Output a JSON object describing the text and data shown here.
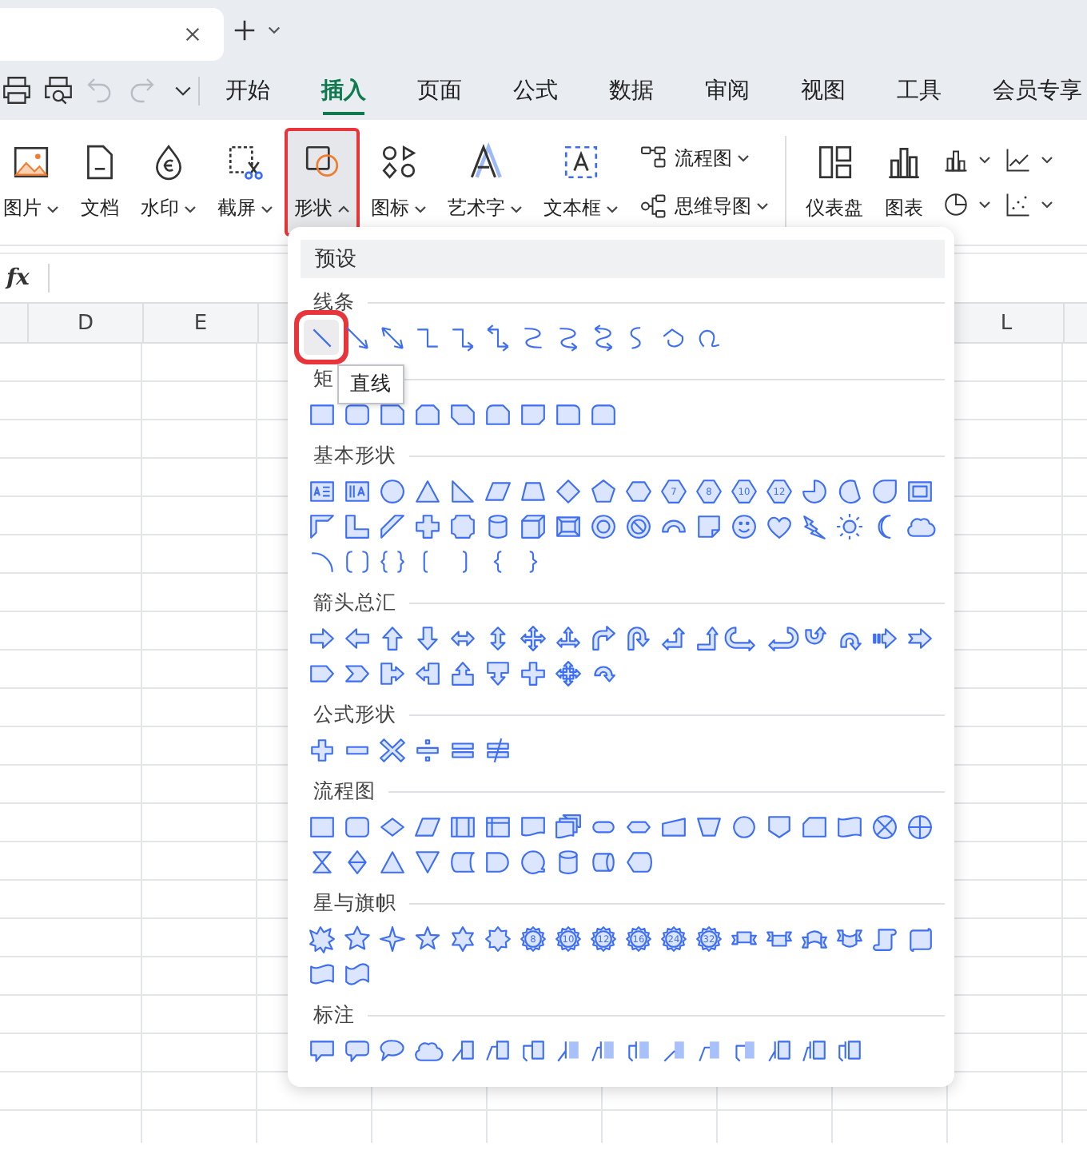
{
  "quick_access": [
    {
      "kind": "print",
      "disabled": false
    },
    {
      "kind": "preview",
      "disabled": false
    },
    {
      "kind": "undo",
      "disabled": true
    },
    {
      "kind": "redo",
      "disabled": true
    },
    {
      "kind": "more",
      "disabled": false
    }
  ],
  "menu_tabs": [
    {
      "label": "开始",
      "selected": false
    },
    {
      "label": "插入",
      "selected": true
    },
    {
      "label": "页面",
      "selected": false
    },
    {
      "label": "公式",
      "selected": false
    },
    {
      "label": "数据",
      "selected": false
    },
    {
      "label": "审阅",
      "selected": false
    },
    {
      "label": "视图",
      "selected": false
    },
    {
      "label": "工具",
      "selected": false
    },
    {
      "label": "会员专享",
      "selected": false
    }
  ],
  "ribbon": {
    "large": [
      {
        "label": "图片",
        "kind": "picture",
        "dropdown": true,
        "expanded": false
      },
      {
        "label": "文档",
        "kind": "document",
        "dropdown": false,
        "expanded": false
      },
      {
        "label": "水印",
        "kind": "watermark",
        "dropdown": true,
        "expanded": false
      },
      {
        "label": "截屏",
        "kind": "screenshot",
        "dropdown": true,
        "expanded": false
      },
      {
        "label": "形状",
        "kind": "shapes",
        "dropdown": true,
        "expanded": true
      },
      {
        "label": "图标",
        "kind": "icons",
        "dropdown": true,
        "expanded": false
      },
      {
        "label": "艺术字",
        "kind": "wordart",
        "dropdown": true,
        "expanded": false
      },
      {
        "label": "文本框",
        "kind": "textbox",
        "dropdown": true,
        "expanded": false
      }
    ],
    "stacked": [
      {
        "label": "流程图",
        "kind": "flowchart",
        "dropdown": true
      },
      {
        "label": "思维导图",
        "kind": "mindmap",
        "dropdown": true
      }
    ],
    "charts": [
      {
        "label": "仪表盘",
        "kind": "dashboard"
      },
      {
        "label": "图表",
        "kind": "chart"
      }
    ],
    "mini": [
      {
        "kind": "barchart",
        "dropdown": true
      },
      {
        "kind": "linechart",
        "dropdown": true
      },
      {
        "kind": "piechart",
        "dropdown": true
      },
      {
        "kind": "scatterchart",
        "dropdown": true
      }
    ]
  },
  "formula_bar": {
    "label": "fx"
  },
  "columns": [
    {
      "label": "D"
    },
    {
      "label": "E"
    },
    {
      "label": "L"
    }
  ],
  "shapes_panel": {
    "header": "预设",
    "tooltip": "直线",
    "sections": [
      {
        "title": "线条",
        "shapes": [
          {
            "kind": "line",
            "selected": true
          },
          {
            "kind": "arrow",
            "selected": false
          },
          {
            "kind": "doublearrow",
            "selected": false
          },
          {
            "kind": "elbow",
            "selected": false
          },
          {
            "kind": "elbowarrow",
            "selected": false
          },
          {
            "kind": "elbowdoublearrow",
            "selected": false
          },
          {
            "kind": "curve",
            "selected": false
          },
          {
            "kind": "curvearrow",
            "selected": false
          },
          {
            "kind": "curvedoublearrow",
            "selected": false
          },
          {
            "kind": "freeform",
            "selected": false
          },
          {
            "kind": "scribble",
            "selected": false
          },
          {
            "kind": "squiggle",
            "selected": false
          }
        ]
      },
      {
        "title": "矩",
        "shapes": [
          {
            "kind": "rectangle",
            "selected": false
          },
          {
            "kind": "rounded",
            "selected": false
          },
          {
            "kind": "snipped",
            "selected": false
          },
          {
            "kind": "snippedpair",
            "selected": false
          },
          {
            "kind": "snippeddiagonal",
            "selected": false
          },
          {
            "kind": "roundsnip",
            "selected": false
          },
          {
            "kind": "snipcorner",
            "selected": false
          },
          {
            "kind": "roundcorner",
            "selected": false
          },
          {
            "kind": "roundtop",
            "selected": false
          }
        ]
      },
      {
        "title": "基本形状",
        "shapes": [
          {
            "kind": "textbox",
            "selected": false
          },
          {
            "kind": "verticaltextbox",
            "selected": false
          },
          {
            "kind": "circle",
            "selected": false
          },
          {
            "kind": "triangle",
            "selected": false
          },
          {
            "kind": "righttriangle",
            "selected": false
          },
          {
            "kind": "parallelogram",
            "selected": false
          },
          {
            "kind": "trapezoid",
            "selected": false
          },
          {
            "kind": "diamond",
            "selected": false
          },
          {
            "kind": "pentagon",
            "selected": false
          },
          {
            "kind": "hexagon",
            "selected": false
          },
          {
            "kind": "polygon",
            "label": "7",
            "selected": false
          },
          {
            "kind": "polygon",
            "label": "8",
            "selected": false
          },
          {
            "kind": "polygon",
            "label": "10",
            "selected": false
          },
          {
            "kind": "polygon",
            "label": "12",
            "selected": false
          },
          {
            "kind": "pie",
            "selected": false
          },
          {
            "kind": "chord",
            "selected": false
          },
          {
            "kind": "teardrop",
            "selected": false
          },
          {
            "kind": "frame",
            "selected": false
          },
          {
            "kind": "halfframe",
            "selected": false
          },
          {
            "kind": "lshape",
            "selected": false
          },
          {
            "kind": "stripe",
            "selected": false
          },
          {
            "kind": "cross",
            "selected": false
          },
          {
            "kind": "plaque",
            "selected": false
          },
          {
            "kind": "can",
            "selected": false
          },
          {
            "kind": "cube",
            "selected": false
          },
          {
            "kind": "bevel",
            "selected": false
          },
          {
            "kind": "donut",
            "selected": false
          },
          {
            "kind": "prohibition",
            "selected": false
          },
          {
            "kind": "blockarc",
            "selected": false
          },
          {
            "kind": "foldedcorner",
            "selected": false
          },
          {
            "kind": "smiley",
            "selected": false
          },
          {
            "kind": "heart",
            "selected": false
          },
          {
            "kind": "lightning",
            "selected": false
          },
          {
            "kind": "sun",
            "selected": false
          },
          {
            "kind": "moon",
            "selected": false
          },
          {
            "kind": "cloud",
            "selected": false
          },
          {
            "kind": "arc",
            "selected": false
          },
          {
            "kind": "bracketpair",
            "selected": false
          },
          {
            "kind": "bracepair",
            "selected": false
          },
          {
            "kind": "leftbracket",
            "selected": false
          },
          {
            "kind": "rightbracket",
            "selected": false
          },
          {
            "kind": "leftbrace",
            "selected": false
          },
          {
            "kind": "rightbrace",
            "selected": false
          }
        ]
      },
      {
        "title": "箭头总汇",
        "shapes": [
          {
            "kind": "rightarrow",
            "selected": false
          },
          {
            "kind": "leftarrow",
            "selected": false
          },
          {
            "kind": "uparrow",
            "selected": false
          },
          {
            "kind": "downarrow",
            "selected": false
          },
          {
            "kind": "leftrightarrow",
            "selected": false
          },
          {
            "kind": "updownarrow",
            "selected": false
          },
          {
            "kind": "quadarrow",
            "selected": false
          },
          {
            "kind": "triarrow",
            "selected": false
          },
          {
            "kind": "bentarrow",
            "selected": false
          },
          {
            "kind": "uturnarrow",
            "selected": false
          },
          {
            "kind": "leftuparrow",
            "selected": false
          },
          {
            "kind": "bentuparrow",
            "selected": false
          },
          {
            "kind": "curvedright",
            "selected": false
          },
          {
            "kind": "curvedleft",
            "selected": false
          },
          {
            "kind": "curvedup",
            "selected": false
          },
          {
            "kind": "curveddown",
            "selected": false
          },
          {
            "kind": "stripedarrow",
            "selected": false
          },
          {
            "kind": "notchedarrow",
            "selected": false
          },
          {
            "kind": "homeplate",
            "selected": false
          },
          {
            "kind": "chevron",
            "selected": false
          },
          {
            "kind": "rightcallout",
            "selected": false
          },
          {
            "kind": "leftcallout",
            "selected": false
          },
          {
            "kind": "upcallout",
            "selected": false
          },
          {
            "kind": "downcallout",
            "selected": false
          },
          {
            "kind": "plusarrow",
            "selected": false
          },
          {
            "kind": "quadcallout",
            "selected": false
          },
          {
            "kind": "circulararrow",
            "selected": false
          }
        ]
      },
      {
        "title": "公式形状",
        "shapes": [
          {
            "kind": "plus",
            "selected": false
          },
          {
            "kind": "minus",
            "selected": false
          },
          {
            "kind": "multiply",
            "selected": false
          },
          {
            "kind": "divide",
            "selected": false
          },
          {
            "kind": "equal",
            "selected": false
          },
          {
            "kind": "notequal",
            "selected": false
          }
        ]
      },
      {
        "title": "流程图",
        "shapes": [
          {
            "kind": "process",
            "selected": false
          },
          {
            "kind": "alternate",
            "selected": false
          },
          {
            "kind": "decision",
            "selected": false
          },
          {
            "kind": "data",
            "selected": false
          },
          {
            "kind": "predefined",
            "selected": false
          },
          {
            "kind": "internalstorage",
            "selected": false
          },
          {
            "kind": "document",
            "selected": false
          },
          {
            "kind": "multidocument",
            "selected": false
          },
          {
            "kind": "terminator",
            "selected": false
          },
          {
            "kind": "preparation",
            "selected": false
          },
          {
            "kind": "manualinput",
            "selected": false
          },
          {
            "kind": "manualoperation",
            "selected": false
          },
          {
            "kind": "connector",
            "selected": false
          },
          {
            "kind": "offpage",
            "selected": false
          },
          {
            "kind": "card",
            "selected": false
          },
          {
            "kind": "tape",
            "selected": false
          },
          {
            "kind": "summing",
            "selected": false
          },
          {
            "kind": "orgate",
            "selected": false
          },
          {
            "kind": "collate",
            "selected": false
          },
          {
            "kind": "sort",
            "selected": false
          },
          {
            "kind": "extract",
            "selected": false
          },
          {
            "kind": "merge",
            "selected": false
          },
          {
            "kind": "storeddata",
            "selected": false
          },
          {
            "kind": "delay",
            "selected": false
          },
          {
            "kind": "sequential",
            "selected": false
          },
          {
            "kind": "magneticdisk",
            "selected": false
          },
          {
            "kind": "directaccess",
            "selected": false
          },
          {
            "kind": "display",
            "selected": false
          }
        ]
      },
      {
        "title": "星与旗帜",
        "shapes": [
          {
            "kind": "explosion",
            "selected": false
          },
          {
            "kind": "blast",
            "selected": false
          },
          {
            "kind": "sparkle",
            "selected": false
          },
          {
            "kind": "star",
            "selected": false
          },
          {
            "kind": "hexagram",
            "selected": false
          },
          {
            "kind": "burst",
            "selected": false
          },
          {
            "kind": "seal",
            "label": "8",
            "selected": false
          },
          {
            "kind": "seal",
            "label": "10",
            "selected": false
          },
          {
            "kind": "seal",
            "label": "12",
            "selected": false
          },
          {
            "kind": "seal",
            "label": "16",
            "selected": false
          },
          {
            "kind": "seal",
            "label": "24",
            "selected": false
          },
          {
            "kind": "seal",
            "label": "32",
            "selected": false
          },
          {
            "kind": "ribbon",
            "selected": false
          },
          {
            "kind": "upribbon",
            "selected": false
          },
          {
            "kind": "curvedribbon",
            "selected": false
          },
          {
            "kind": "upcurvedribbon",
            "selected": false
          },
          {
            "kind": "verticalscroll",
            "selected": false
          },
          {
            "kind": "horizontalscroll",
            "selected": false
          },
          {
            "kind": "wave",
            "selected": false
          },
          {
            "kind": "doublewave",
            "selected": false
          }
        ]
      },
      {
        "title": "标注",
        "shapes": [
          {
            "kind": "speech",
            "selected": false
          },
          {
            "kind": "roundspeech",
            "selected": false
          },
          {
            "kind": "ovalspeech",
            "selected": false
          },
          {
            "kind": "cloudspeech",
            "selected": false
          },
          {
            "kind": "linecallout",
            "selected": false
          },
          {
            "kind": "bentcallout",
            "selected": false
          },
          {
            "kind": "elbowcallout",
            "selected": false
          },
          {
            "kind": "accentcallout",
            "selected": false
          },
          {
            "kind": "accentbent",
            "selected": false
          },
          {
            "kind": "accentelbow",
            "selected": false
          },
          {
            "kind": "filledcallout",
            "selected": false
          },
          {
            "kind": "filledbent",
            "selected": false
          },
          {
            "kind": "filledelbow",
            "selected": false
          },
          {
            "kind": "bordercallout",
            "selected": false
          },
          {
            "kind": "borderbent",
            "selected": false
          },
          {
            "kind": "borderelbow",
            "selected": false
          }
        ]
      }
    ]
  }
}
